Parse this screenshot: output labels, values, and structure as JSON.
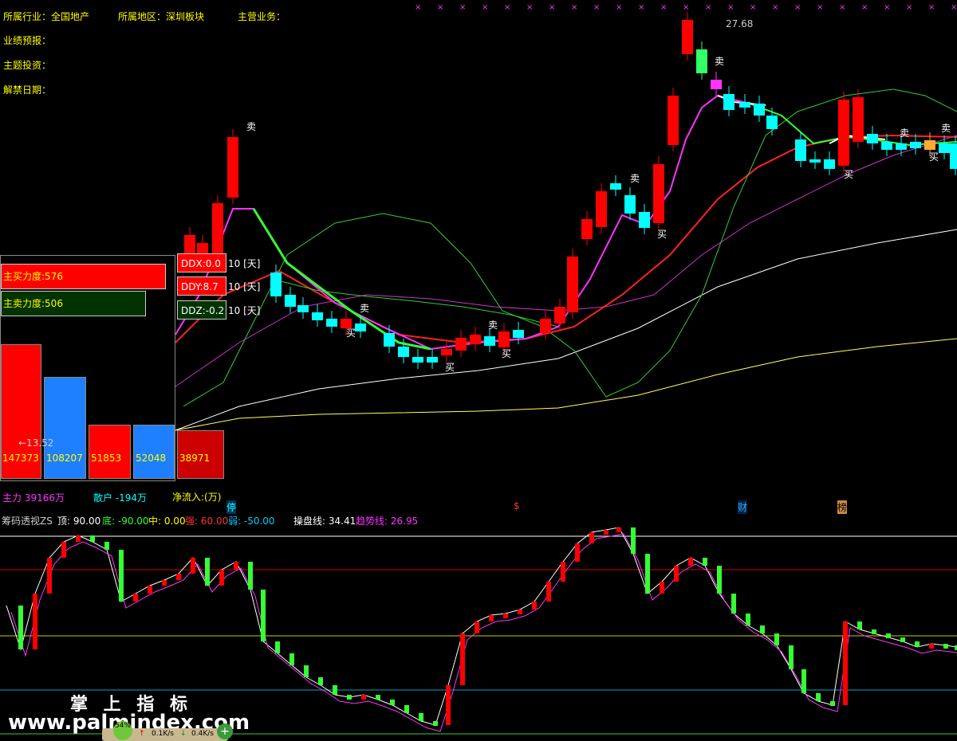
{
  "header": {
    "industry_label": "所属行业：全国地产",
    "region_label": "所属地区：深圳板块",
    "business_label": "主营业务：",
    "forecast_label": "业绩预报：",
    "theme_label": "主题投资：",
    "unlock_label": "解禁日期："
  },
  "price_high_marker": "27.68",
  "price_low_marker": "←13.52",
  "panel": {
    "main_buy": "主买力度:576",
    "main_sell": "主卖力度:506",
    "bars": [
      {
        "value": "147373",
        "color": "#ff0000"
      },
      {
        "value": "108207",
        "color": "#1e7fff"
      },
      {
        "value": "51853",
        "color": "#ff0000"
      },
      {
        "value": "52048",
        "color": "#1e7fff"
      },
      {
        "value": "38971",
        "color": "#cc0000"
      }
    ],
    "main_force": "主力 39166万",
    "retail": "散户 -194万",
    "net_inflow": "净流入:(万)"
  },
  "dd": {
    "ddx": "DDX:0.0",
    "ddx_days": "10 [天]",
    "ddy": "DDY:8.7",
    "ddy_days": "10 [天]",
    "ddz": "DDZ:-0.2",
    "ddz_days": "10 [天]"
  },
  "markers": {
    "buy": "买",
    "sell": "卖",
    "stop": "停",
    "dollar": "$",
    "finance": "财",
    "list": "榜"
  },
  "indicator": {
    "name": "筹码透视ZS",
    "top": "顶: 90.00",
    "bottom": "底: -90.00",
    "mid": "中: 0.00",
    "strong": "强: 60.00",
    "weak": "弱: -50.00",
    "trade_line": "操盘线: 34.41",
    "trend_line": "趋势线: 26.95"
  },
  "watermark": {
    "title": "掌 上 指 标",
    "url": "www.palmindex.com"
  },
  "status": {
    "battery": "54%",
    "up_speed": "0.1K/s",
    "down_speed": "0.4K/s"
  },
  "colors": {
    "up": "#ff0000",
    "down": "#00ffff",
    "ma_magenta": "#ff33ff",
    "ma_green": "#33ff33",
    "indicator_white": "#ffffff"
  }
}
